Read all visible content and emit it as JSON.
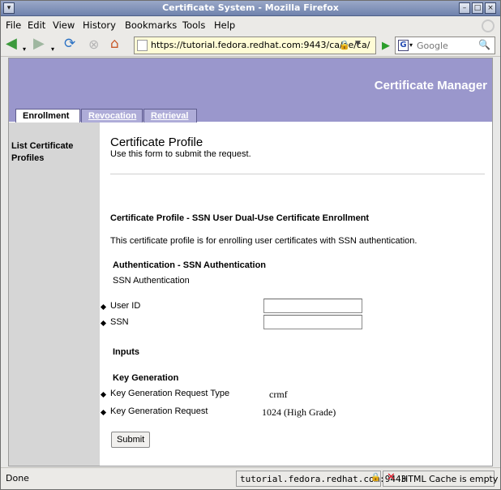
{
  "window": {
    "title": "Certificate System - Mozilla Firefox"
  },
  "menubar": {
    "items": [
      "File",
      "Edit",
      "View",
      "History",
      "Bookmarks",
      "Tools",
      "Help"
    ]
  },
  "navbar": {
    "url": "https://tutorial.fedora.redhat.com:9443/ca/ee/ca/",
    "search_placeholder": "Google"
  },
  "header": {
    "brand": "Certificate Manager"
  },
  "tabs": [
    {
      "label": "Enrollment",
      "active": true
    },
    {
      "label": "Revocation",
      "active": false
    },
    {
      "label": "Retrieval",
      "active": false
    }
  ],
  "sidebar": {
    "link": "List Certificate Profiles"
  },
  "page": {
    "title": "Certificate Profile",
    "subtitle": "Use this form to submit the request.",
    "profile_heading": "Certificate Profile - SSN User Dual-Use Certificate Enrollment",
    "profile_description": "This certificate profile is for enrolling user certificates with SSN authentication.",
    "auth_heading": "Authentication - SSN Authentication",
    "auth_name": "SSN Authentication",
    "fields": {
      "user_id_label": "User ID",
      "user_id_value": "",
      "ssn_label": "SSN",
      "ssn_value": ""
    },
    "inputs_heading": "Inputs",
    "keygen_heading": "Key Generation",
    "keygen_type_label": "Key Generation Request Type",
    "keygen_type_value": "crmf",
    "keygen_request_label": "Key Generation Request",
    "keygen_request_value": "1024 (High Grade)",
    "submit_label": "Submit"
  },
  "statusbar": {
    "status": "Done",
    "host": "tutorial.fedora.redhat.com:9443",
    "cache": "HTML Cache is empty"
  }
}
